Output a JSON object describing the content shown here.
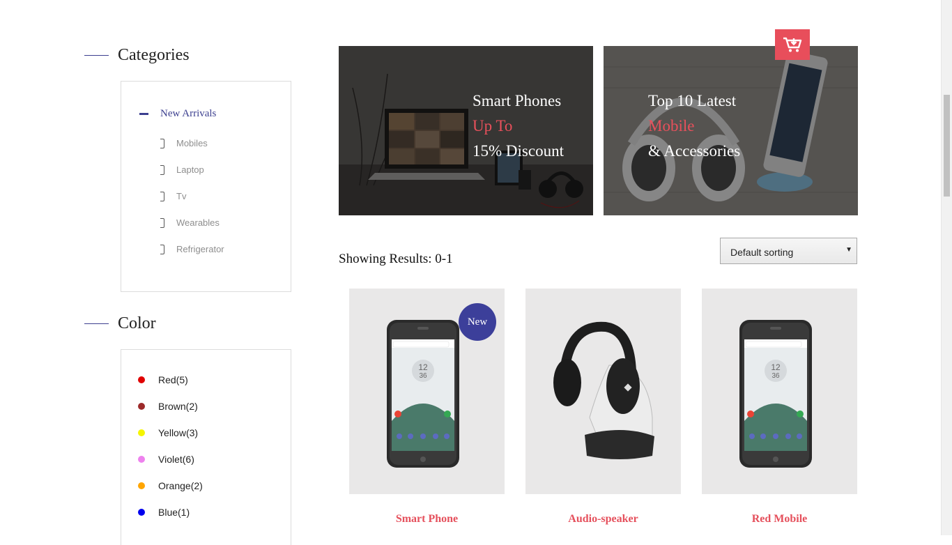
{
  "sidebar": {
    "categories_title": "Categories",
    "parent": {
      "label": "New Arrivals"
    },
    "subcategories": [
      "Mobiles",
      "Laptop",
      "Tv",
      "Wearables",
      "Refrigerator"
    ],
    "color_title": "Color",
    "colors": [
      {
        "label": "Red(5)",
        "hex": "#e00000"
      },
      {
        "label": "Brown(2)",
        "hex": "#9c2a2a"
      },
      {
        "label": "Yellow(3)",
        "hex": "#f5f500"
      },
      {
        "label": "Violet(6)",
        "hex": "#ee82ee"
      },
      {
        "label": "Orange(2)",
        "hex": "#ffa500"
      },
      {
        "label": "Blue(1)",
        "hex": "#0000ee"
      }
    ]
  },
  "banners": [
    {
      "line1": "Smart Phones",
      "line2": "Up To",
      "line3": "15% Discount"
    },
    {
      "line1": "Top 10 Latest",
      "line2": "Mobile",
      "line3": "& Accessories"
    }
  ],
  "cart_icon": "cart-download-icon",
  "results_text": "Showing Results: 0-1",
  "sort": {
    "selected": "Default sorting",
    "arrow": "▼"
  },
  "products": [
    {
      "name": "Smart Phone",
      "badge": "New"
    },
    {
      "name": "Audio-speaker"
    },
    {
      "name": "Red Mobile"
    }
  ],
  "colors": {
    "accent": "#3c3f8f",
    "highlight": "#e8505b",
    "cart": "#e84e5b"
  }
}
